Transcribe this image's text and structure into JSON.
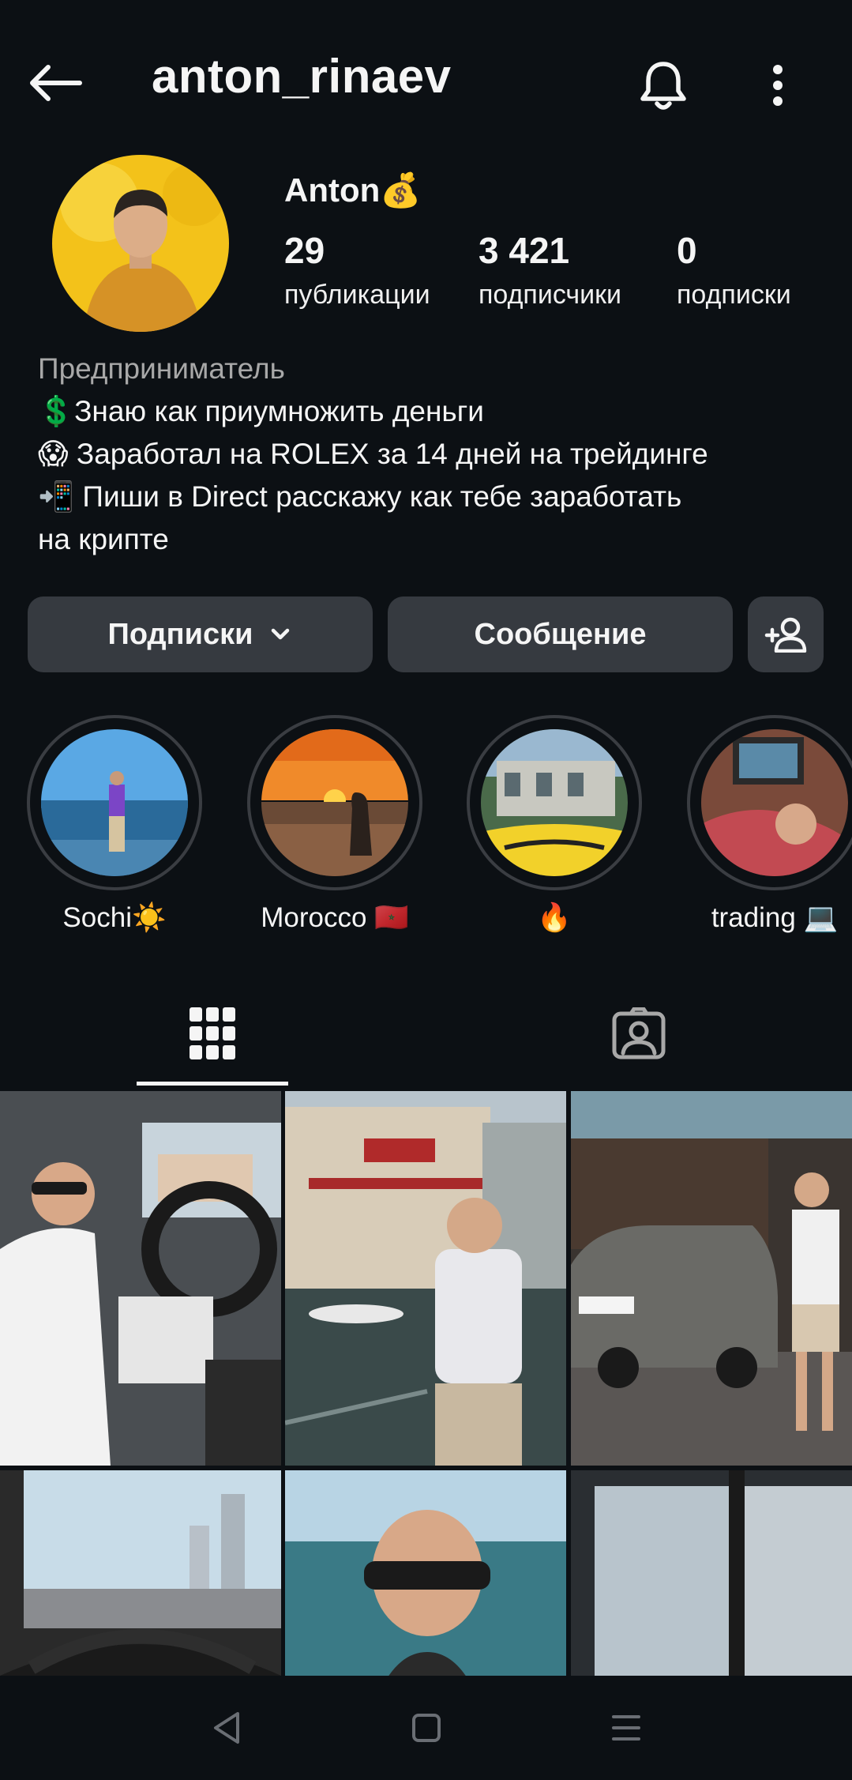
{
  "header": {
    "username": "anton_rinaev"
  },
  "profile": {
    "display_name": "Anton💰",
    "stats": [
      {
        "value": "29",
        "label": "публикации"
      },
      {
        "value": "3 421",
        "label": "подписчики"
      },
      {
        "value": "0",
        "label": "подписки"
      }
    ],
    "bio_category": "Предприниматель",
    "bio_lines": [
      "💲Знаю как приумножить деньги",
      "😱 Заработал на ROLEX за 14 дней на трейдинге",
      "📲 Пиши в Direct расскажу как тебе заработать",
      "на крипте"
    ]
  },
  "buttons": {
    "following_label": "Подписки",
    "message_label": "Сообщение"
  },
  "highlights": [
    {
      "label": "Sochi☀️"
    },
    {
      "label": "Morocco 🇲🇦"
    },
    {
      "label": "🔥"
    },
    {
      "label": "trading 💻"
    }
  ],
  "colors": {
    "background": "#0c1014",
    "button_bg": "#363a40",
    "secondary_text": "#a8a8a8"
  }
}
